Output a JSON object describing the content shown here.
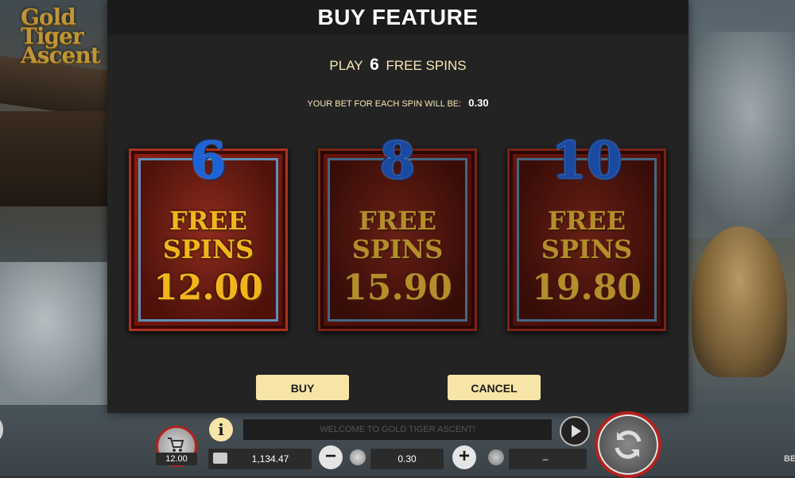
{
  "game": {
    "logo_text": "Gold Tiger Ascent"
  },
  "dialog": {
    "title": "BUY FEATURE",
    "play_prefix": "PLAY",
    "play_count": "6",
    "play_suffix": "FREE SPINS",
    "bet_label": "YOUR BET FOR EACH SPIN WILL BE:",
    "bet_value": "0.30",
    "options": [
      {
        "count": "6",
        "line1": "FREE",
        "line2": "SPINS",
        "price": "12.00",
        "selected": true
      },
      {
        "count": "8",
        "line1": "FREE",
        "line2": "SPINS",
        "price": "15.90",
        "selected": false
      },
      {
        "count": "10",
        "line1": "FREE",
        "line2": "SPINS",
        "price": "19.80",
        "selected": false
      }
    ],
    "buy_label": "BUY",
    "cancel_label": "CANCEL"
  },
  "bottom_bar": {
    "buy_feature_amount": "12.00",
    "info_label": "i",
    "message": "WELCOME TO GOLD TIGER ASCENT!",
    "balance": "1,134.47",
    "bet": "0.30",
    "win": "–",
    "edge_text": "BE"
  },
  "colors": {
    "accent": "#f6e5a6",
    "spin_ring": "#b3221e",
    "card_red": "#8b1e12",
    "number_blue": "#1e63d6",
    "gold_text": "#f2b51c"
  }
}
